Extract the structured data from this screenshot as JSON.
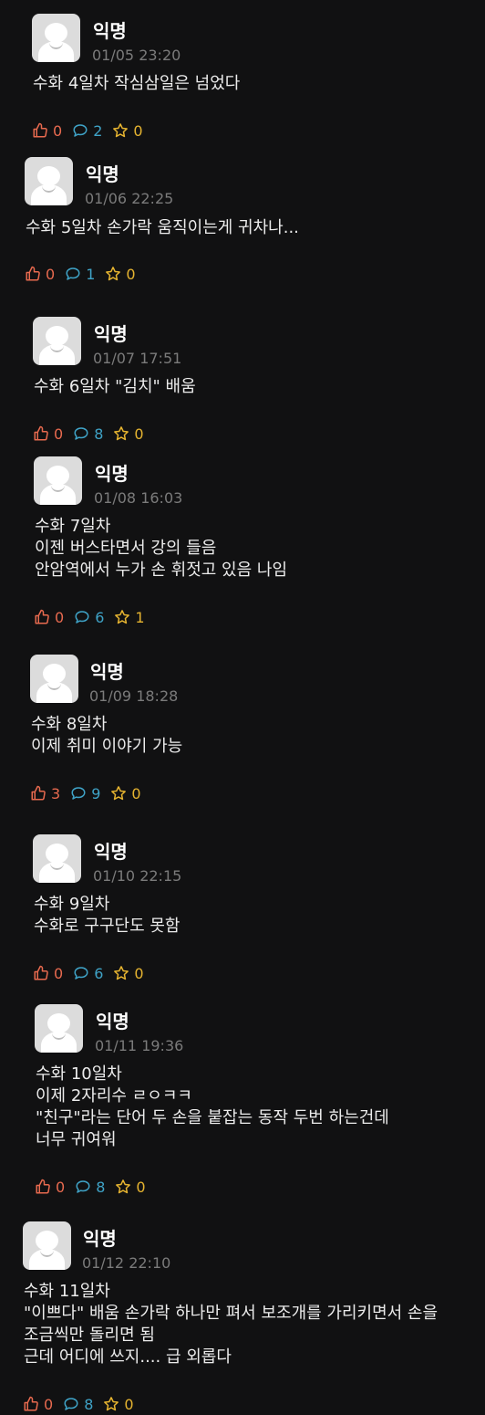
{
  "posts": [
    {
      "author": "익명",
      "date": "01/05 23:20",
      "lines": [
        "수화 4일차 작심삼일은 넘었다"
      ],
      "likes": "0",
      "comments": "2",
      "stars": "0"
    },
    {
      "author": "익명",
      "date": "01/06 22:25",
      "lines": [
        "수화 5일차 손가락 움직이는게 귀차나..."
      ],
      "likes": "0",
      "comments": "1",
      "stars": "0"
    },
    {
      "author": "익명",
      "date": "01/07 17:51",
      "lines": [
        "수화 6일차 \"김치\" 배움"
      ],
      "likes": "0",
      "comments": "8",
      "stars": "0"
    },
    {
      "author": "익명",
      "date": "01/08 16:03",
      "lines": [
        "수화 7일차",
        "이젠 버스타면서 강의 들음",
        "안암역에서 누가 손 휘젓고 있음 나임"
      ],
      "likes": "0",
      "comments": "6",
      "stars": "1"
    },
    {
      "author": "익명",
      "date": "01/09 18:28",
      "lines": [
        "수화 8일차",
        "이제 취미 이야기 가능"
      ],
      "likes": "3",
      "comments": "9",
      "stars": "0"
    },
    {
      "author": "익명",
      "date": "01/10 22:15",
      "lines": [
        "수화 9일차",
        "수화로 구구단도 못함"
      ],
      "likes": "0",
      "comments": "6",
      "stars": "0"
    },
    {
      "author": "익명",
      "date": "01/11 19:36",
      "lines": [
        "수화 10일차",
        "이제 2자리수 ㄹㅇㅋㅋ",
        "\"친구\"라는 단어 두 손을 붙잡는 동작 두번 하는건데",
        "너무 귀여워"
      ],
      "likes": "0",
      "comments": "8",
      "stars": "0"
    },
    {
      "author": "익명",
      "date": "01/12 22:10",
      "lines": [
        "수화 11일차",
        "\"이쁘다\" 배움 손가락 하나만 펴서 보조개를 가리키면서 손을",
        "조금씩만 돌리면 됨",
        "근데 어디에 쓰지.... 급 외롭다"
      ],
      "likes": "0",
      "comments": "8",
      "stars": "0"
    }
  ]
}
